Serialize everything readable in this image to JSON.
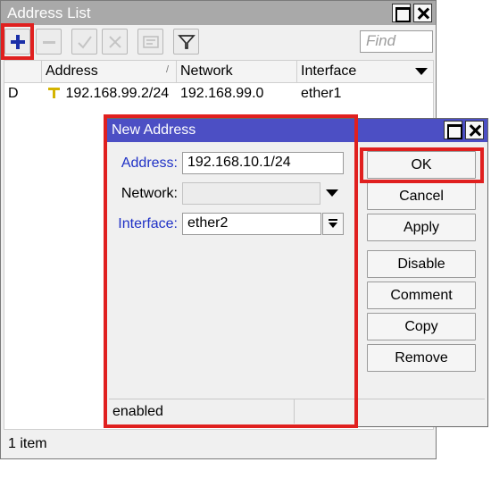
{
  "address_list": {
    "title": "Address List",
    "toolbar": {
      "add": "plus-icon",
      "remove": "minus-icon",
      "enable": "check-icon",
      "disable": "x-icon",
      "comment": "comment-icon",
      "filter": "filter-icon"
    },
    "find_placeholder": "Find",
    "columns": [
      "Address",
      "Network",
      "Interface"
    ],
    "sort_mark": "/",
    "rows": [
      {
        "flag": "D",
        "address": "192.168.99.2/24",
        "network": "192.168.99.0",
        "interface": "ether1"
      }
    ],
    "status": "1 item"
  },
  "new_address": {
    "title": "New Address",
    "fields": {
      "address_label": "Address:",
      "address_value": "192.168.10.1/24",
      "network_label": "Network:",
      "network_value": "",
      "interface_label": "Interface:",
      "interface_value": "ether2"
    },
    "buttons": {
      "ok": "OK",
      "cancel": "Cancel",
      "apply": "Apply",
      "disable": "Disable",
      "comment": "Comment",
      "copy": "Copy",
      "remove": "Remove"
    },
    "status": "enabled"
  },
  "colors": {
    "highlight": "#e0201f",
    "dialog_titlebar": "#4c4fc4",
    "required_label": "#1f31c6",
    "add_icon": "#1a2fa8"
  }
}
